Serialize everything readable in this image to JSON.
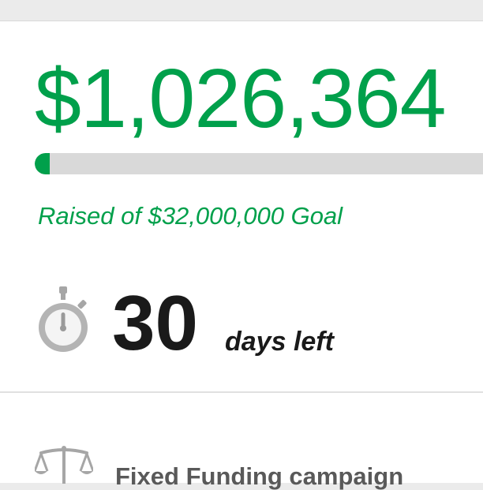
{
  "campaign": {
    "raised_amount": "$1,026,364",
    "goal_text": "Raised of $32,000,000 Goal",
    "progress_fraction": 0.032,
    "days_number": "30",
    "days_label": "days left",
    "funding_type": "Fixed Funding campaign"
  },
  "icons": {
    "timer": "stopwatch-icon",
    "funding": "scales-icon"
  },
  "colors": {
    "accent_green": "#00a04b",
    "progress_track": "#d9d9d9",
    "icon_gray": "#a6a6a6"
  }
}
